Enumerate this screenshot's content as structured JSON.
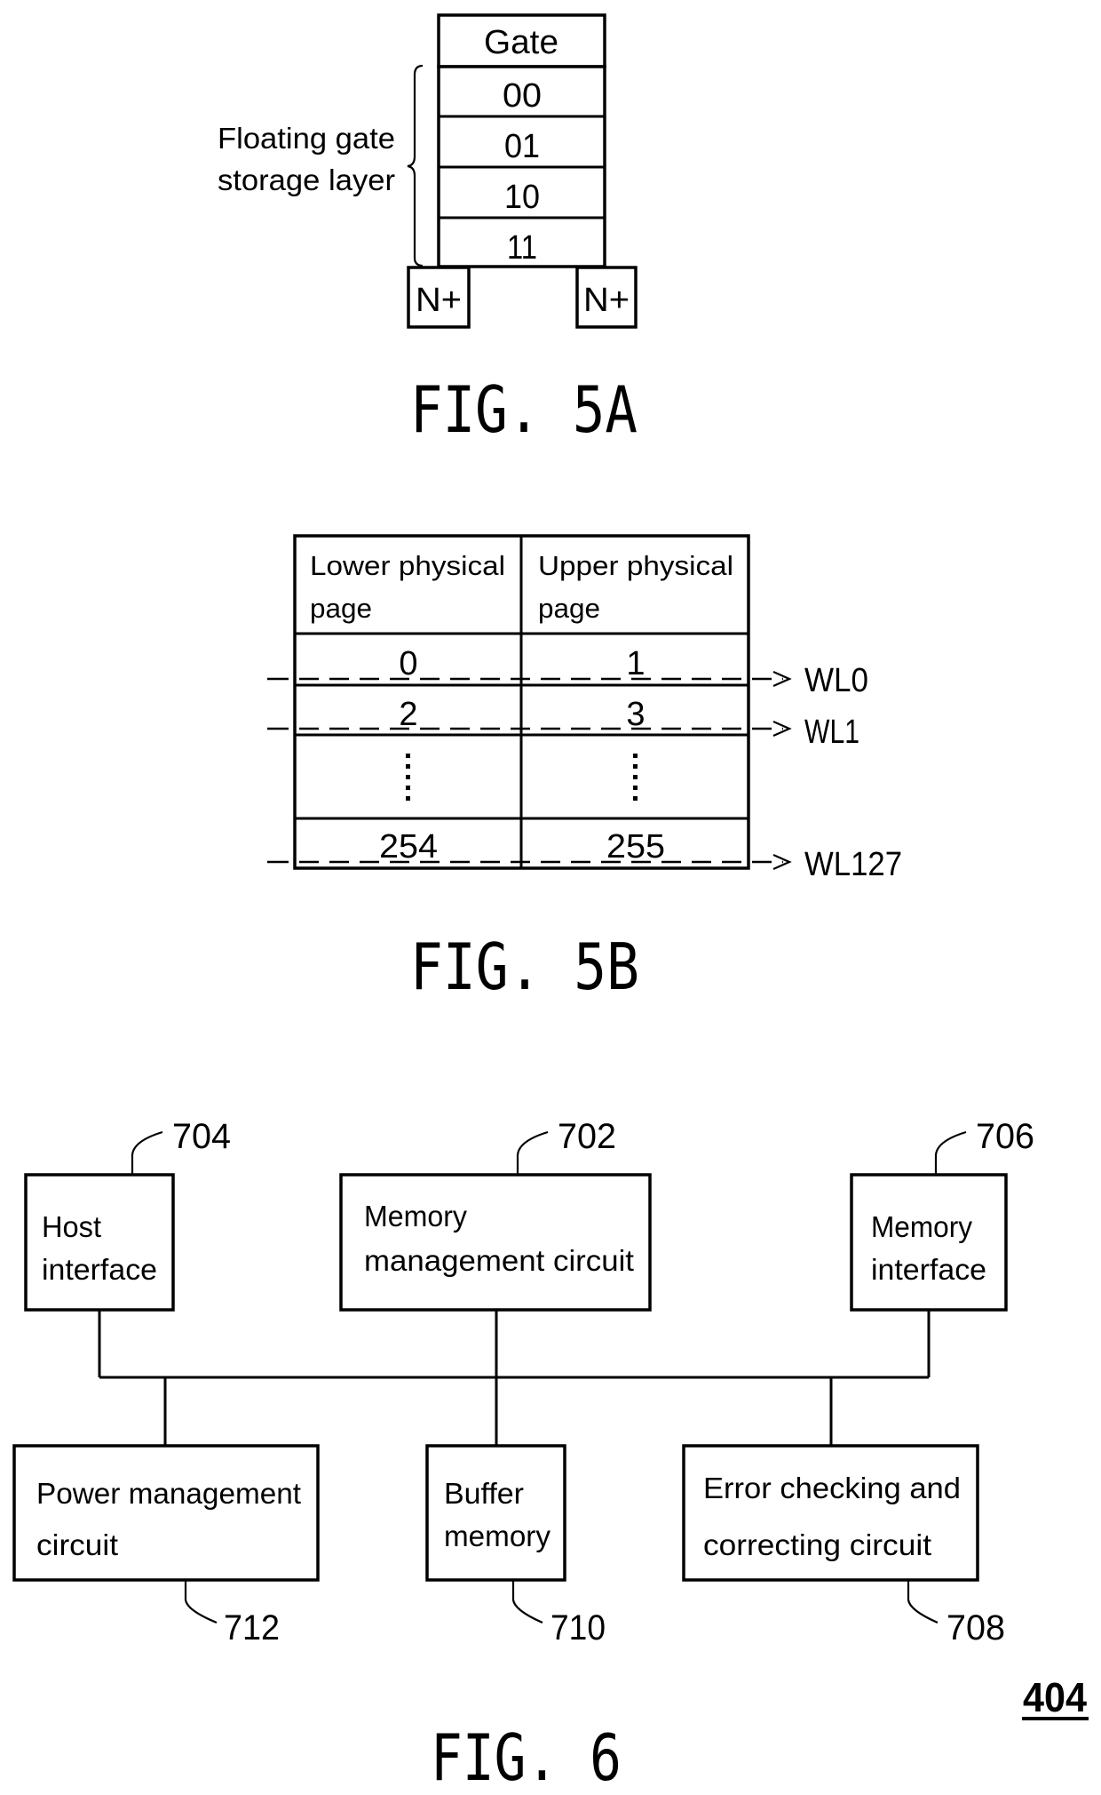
{
  "fig5a": {
    "caption": "FIG. 5A",
    "gate_label": "Gate",
    "layers": [
      "00",
      "01",
      "10",
      "11"
    ],
    "brace_label_line1": "Floating gate",
    "brace_label_line2": "storage layer",
    "source_label": "N+",
    "drain_label": "N+"
  },
  "fig5b": {
    "caption": "FIG. 5B",
    "headers": [
      {
        "line1": "Lower physical",
        "line2": "page"
      },
      {
        "line1": "Upper physical",
        "line2": "page"
      }
    ],
    "rows": [
      {
        "lower": "0",
        "upper": "1",
        "word_line": "WL0"
      },
      {
        "lower": "2",
        "upper": "3",
        "word_line": "WL1"
      },
      {
        "lower": "⋮",
        "upper": "⋮",
        "word_line": ""
      },
      {
        "lower": "254",
        "upper": "255",
        "word_line": "WL127"
      }
    ]
  },
  "fig6": {
    "caption": "FIG. 6",
    "reference": "404",
    "blocks": {
      "host_interface": {
        "line1": "Host",
        "line2": "interface",
        "ref": "704"
      },
      "memory_management": {
        "line1": "Memory",
        "line2": "management circuit",
        "ref": "702"
      },
      "memory_interface": {
        "line1": "Memory",
        "line2": "interface",
        "ref": "706"
      },
      "power_management": {
        "line1": "Power management",
        "line2": "circuit",
        "ref": "712"
      },
      "buffer_memory": {
        "line1": "Buffer",
        "line2": "memory",
        "ref": "710"
      },
      "ecc": {
        "line1": "Error checking and",
        "line2": "correcting circuit",
        "ref": "708"
      }
    }
  }
}
